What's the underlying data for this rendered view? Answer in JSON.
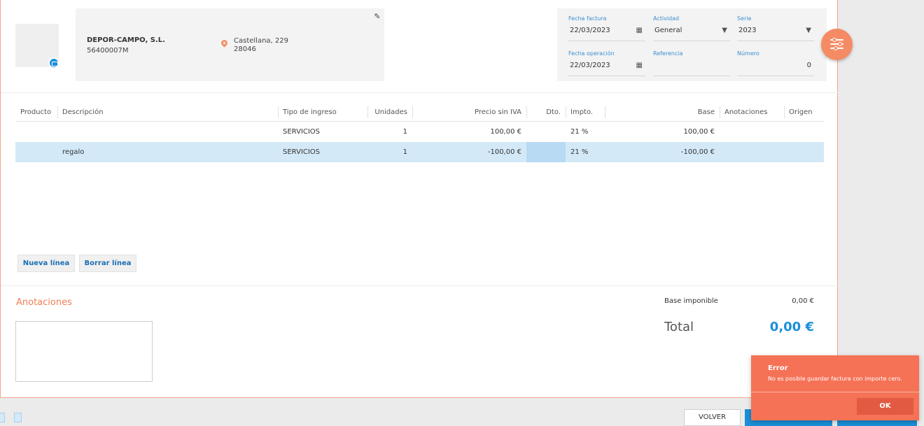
{
  "customer": {
    "name": "DEPOR-CAMPO, S.L.",
    "tax_id": "56400007M",
    "address_line1": "Castellana, 229",
    "address_line2": "28046"
  },
  "invoice": {
    "fecha_factura": {
      "label": "Fecha factura",
      "value": "22/03/2023"
    },
    "actividad": {
      "label": "Actividad",
      "value": "General"
    },
    "serie": {
      "label": "Serie",
      "value": "2023"
    },
    "fecha_operacion": {
      "label": "Fecha operación",
      "value": "22/03/2023"
    },
    "referencia": {
      "label": "Referencia",
      "value": ""
    },
    "numero": {
      "label": "Número",
      "value": "0"
    }
  },
  "table": {
    "headers": [
      "Producto",
      "Descripción",
      "Tipo de ingreso",
      "Unidades",
      "Precio sin IVA",
      "Dto.",
      "Impto.",
      "Base",
      "Anotaciones",
      "Origen"
    ],
    "rows": [
      {
        "producto": "",
        "descripcion": "",
        "tipo": "SERVICIOS",
        "unidades": "1",
        "precio": "100,00 €",
        "dto": "",
        "impto": "21 %",
        "base": "100,00 €",
        "anotaciones": "",
        "origen": ""
      },
      {
        "producto": "",
        "descripcion": "regalo",
        "tipo": "SERVICIOS",
        "unidades": "1",
        "precio": "-100,00 €",
        "dto": "",
        "impto": "21 %",
        "base": "-100,00 €",
        "anotaciones": "",
        "origen": ""
      }
    ]
  },
  "buttons": {
    "nueva_linea": "Nueva línea",
    "borrar_linea": "Borrar línea",
    "volver": "VOLVER"
  },
  "notes": {
    "title": "Anotaciones"
  },
  "summary": {
    "base_label": "Base imponible",
    "base_value": "0,00 €",
    "total_label": "Total",
    "total_value": "0,00 €"
  },
  "toast": {
    "title": "Error",
    "message": "No es posible guardar factura con importe cero.",
    "ok_label": "OK"
  },
  "colors": {
    "accent": "#f58b64",
    "brand_blue": "#1a8fd8",
    "error": "#f57256"
  }
}
